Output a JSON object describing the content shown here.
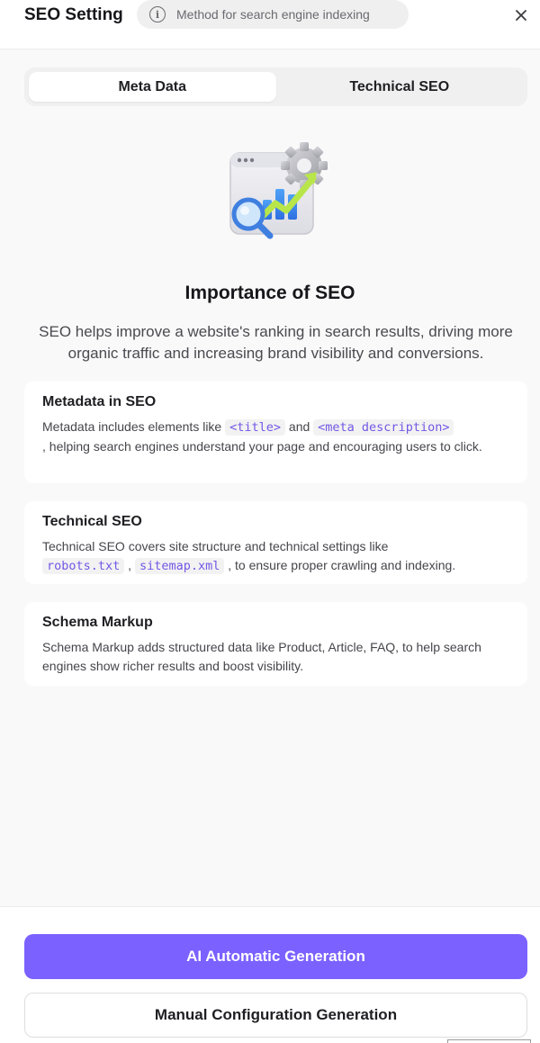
{
  "header": {
    "title": "SEO Setting",
    "hint": "Method for search engine indexing",
    "info_icon": "info-circle-icon",
    "close_icon": "close-icon"
  },
  "tabs": [
    {
      "label": "Meta Data",
      "active": true
    },
    {
      "label": "Technical SEO",
      "active": false
    }
  ],
  "illustration": "seo-analytics-icon",
  "section": {
    "title": "Importance of SEO",
    "description": "SEO helps improve a website's ranking in search results, driving more organic traffic and increasing brand visibility and conversions."
  },
  "cards": [
    {
      "title": "Metadata in SEO",
      "text_1": "Metadata includes elements like ",
      "code_1": "<title>",
      "text_2": " and ",
      "code_2": "<meta description>",
      "text_3": ", helping search engines understand your page and encouraging users to click."
    },
    {
      "title": "Technical SEO",
      "text_1": "Technical SEO covers site structure and technical settings like ",
      "code_1": "robots.txt",
      "text_2": " , ",
      "code_2": "sitemap.xml",
      "text_3": " , to ensure proper crawling and indexing."
    },
    {
      "title": "Schema Markup",
      "text_1": "Schema Markup adds structured data like Product, Article, FAQ, to help search engines show richer results and boost visibility."
    }
  ],
  "actions": {
    "primary": "AI Automatic Generation",
    "secondary": "Manual Configuration Generation"
  },
  "colors": {
    "accent": "#7b61ff",
    "code_text": "#7457e6",
    "background": "#f9f9f9"
  }
}
